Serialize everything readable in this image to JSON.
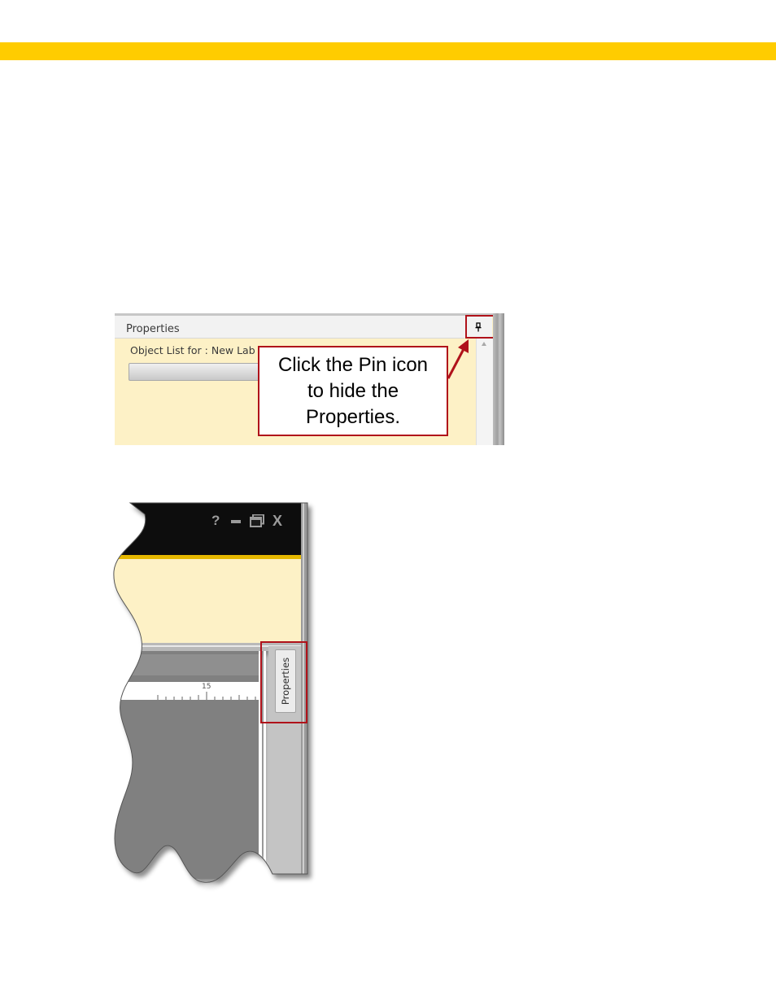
{
  "colors": {
    "top_bar": "#ffcc00",
    "panel_bg": "#fdf1c6",
    "highlight": "#b0121a",
    "title_bar": "#101010",
    "canvas": "#808080"
  },
  "screenshot_top": {
    "panel_title": "Properties",
    "object_list_label": "Object List for :  New Lab",
    "pin_icon": "pin-icon",
    "callout_lines": [
      "Click the Pin icon",
      "to hide the",
      "Properties."
    ]
  },
  "screenshot_bottom": {
    "window_controls": {
      "help": "?",
      "minimize_icon": "minimize-icon",
      "maximize_icon": "maximize-icon",
      "close": "X"
    },
    "ruler_label": "15",
    "collapsed_tab_label": "Properties"
  }
}
